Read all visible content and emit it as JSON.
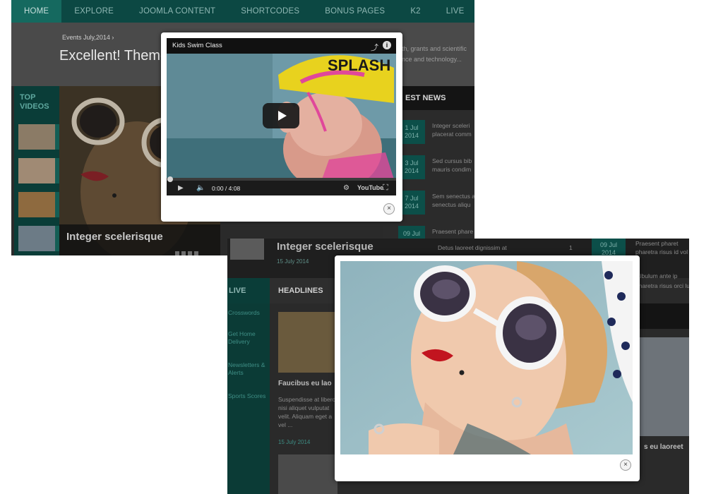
{
  "nav": {
    "items": [
      "Home",
      "Explore",
      "Joomla Content",
      "Shortcodes",
      "Bonus Pages",
      "K2",
      "Live"
    ]
  },
  "top": {
    "events": "Events July,2014 ›",
    "headline": "Excellent! Theme",
    "grants": [
      "th, grants and scientific",
      "nce and technology..."
    ]
  },
  "top_videos": {
    "title_line1": "TOP",
    "title_line2": "VIDEOS"
  },
  "hero": {
    "caption": "Integer scelerisque"
  },
  "latest_news": {
    "title": "EST NEWS",
    "items": [
      {
        "date_line1": "1 Jul",
        "date_line2": "2014",
        "text_line1": "Integer sceleri",
        "text_line2": "placerat comm"
      },
      {
        "date_line1": "3 Jul",
        "date_line2": "2014",
        "text_line1": "Sed cursus bib",
        "text_line2": "mauris condim"
      },
      {
        "date_line1": "7 Jul",
        "date_line2": "2014",
        "text_line1": "Sem senectus a",
        "text_line2": "senectus aliqu"
      },
      {
        "date_line1": "09 Jul",
        "date_line2": "",
        "text_line1": "Praesent phare",
        "text_line2": ""
      }
    ]
  },
  "video_modal": {
    "title": "Kids Swim Class",
    "time": "0:00 / 4:08",
    "brand": "YouTube",
    "close": "×",
    "progress": 0
  },
  "shot2": {
    "hero_title": "Integer scelerisque",
    "hero_date": "15 July 2014",
    "tab_live": "LIVE",
    "tab_headlines": "HEADLINES",
    "sidebar": [
      "Crosswords",
      "Get Home Delivery",
      "Newsletters & Alerts",
      "Sports Scores"
    ],
    "card": {
      "title": "Faucibus eu lao",
      "text": "Suspendisse at libero nisi aliquet vulputat velit. Aliquam eget a vel ...",
      "date": "15 July 2014"
    },
    "right": {
      "date_line1": "09 Jul",
      "date_line2": "2014",
      "lines": [
        "Praesent pharet",
        "pharetra risus id vol",
        "stibulum ante ip",
        "pharetra risus orci luctus"
      ],
      "title": "s eu laoreet"
    },
    "dim_text": "Detus laoreet dignissim at",
    "dim_count": "1"
  },
  "image_modal": {
    "close": "×"
  }
}
